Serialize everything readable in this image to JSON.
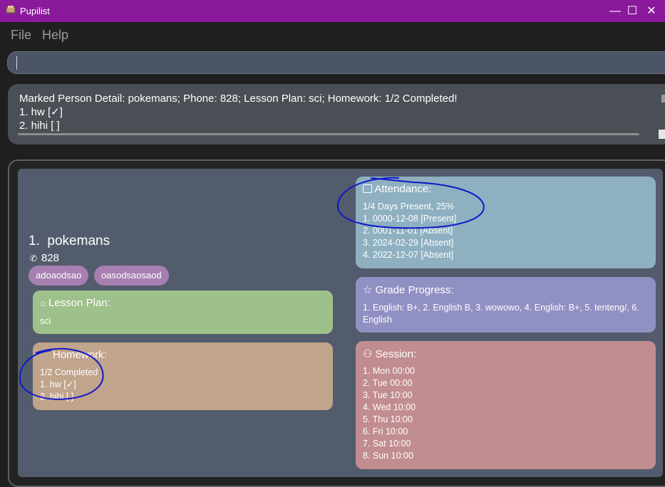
{
  "window": {
    "title": "Pupilist",
    "controls": {
      "minimize": "—",
      "maximize": "☐",
      "close": "✕"
    }
  },
  "menu": {
    "items": [
      "File",
      "Help"
    ]
  },
  "command": {
    "value": ""
  },
  "result": {
    "lines": [
      "Marked Person Detail: pokemans; Phone: 828; Lesson Plan: sci; Homework: 1/2 Completed!",
      "1. hw [✓]",
      "2. hihi [ ]"
    ]
  },
  "person": {
    "index": "1.",
    "name": "pokemans",
    "phone": "828",
    "tags": [
      "adoaodsao",
      "oasodsaosaod"
    ],
    "lesson_plan": {
      "title": "Lesson Plan:",
      "body": "sci"
    },
    "homework": {
      "title": "Homework:",
      "lines": [
        "1/2 Completed",
        "1. hw [✓]",
        "2. hihi [ ]"
      ]
    },
    "attendance": {
      "title": "Attendance:",
      "lines": [
        "1/4 Days Present, 25%",
        "1. 0000-12-08 [Present]",
        "2. 0001-11-01 [Absent]",
        "3. 2024-02-29 [Absent]",
        "4. 2022-12-07 [Absent]"
      ]
    },
    "grades": {
      "title": "Grade Progress:",
      "lines": [
        "1. English: B+, 2. English B, 3. wowowo, 4. English: B+, 5. tenteng/, 6.",
        "English"
      ]
    },
    "session": {
      "title": "Session:",
      "lines": [
        "1. Mon 00:00",
        "2. Tue 00:00",
        "3. Tue 10:00",
        "4. Wed 10:00",
        "5. Thu 10:00",
        "6. Fri 10:00",
        "7. Sat 10:00",
        "8. Sun 10:00"
      ]
    }
  },
  "colors": {
    "titlebar": "#8a1a9b",
    "lesson_panel": "#9ec08a",
    "homework_panel": "#c1a48c",
    "attendance_panel": "#8eb0c1",
    "grade_panel": "#9190c3",
    "session_panel": "#c28d90",
    "tag": "#a77fb1",
    "annotation": "#1019c8"
  }
}
